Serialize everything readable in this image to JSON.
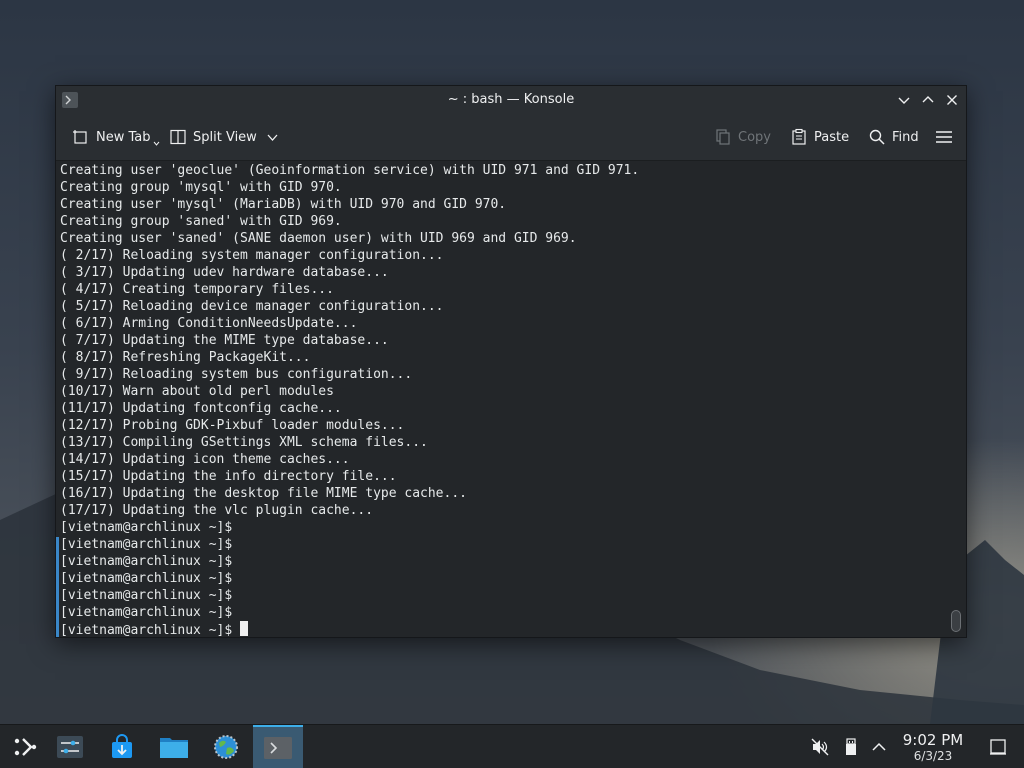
{
  "window": {
    "title": "~ : bash — Konsole"
  },
  "toolbar": {
    "new_tab_label": "New Tab",
    "split_view_label": "Split View",
    "copy_label": "Copy",
    "paste_label": "Paste",
    "find_label": "Find"
  },
  "terminal": {
    "lines": [
      "Creating user 'geoclue' (Geoinformation service) with UID 971 and GID 971.",
      "Creating group 'mysql' with GID 970.",
      "Creating user 'mysql' (MariaDB) with UID 970 and GID 970.",
      "Creating group 'saned' with GID 969.",
      "Creating user 'saned' (SANE daemon user) with UID 969 and GID 969.",
      "( 2/17) Reloading system manager configuration...",
      "( 3/17) Updating udev hardware database...",
      "( 4/17) Creating temporary files...",
      "( 5/17) Reloading device manager configuration...",
      "( 6/17) Arming ConditionNeedsUpdate...",
      "( 7/17) Updating the MIME type database...",
      "( 8/17) Refreshing PackageKit...",
      "( 9/17) Reloading system bus configuration...",
      "(10/17) Warn about old perl modules",
      "(11/17) Updating fontconfig cache...",
      "(12/17) Probing GDK-Pixbuf loader modules...",
      "(13/17) Compiling GSettings XML schema files...",
      "(14/17) Updating icon theme caches...",
      "(15/17) Updating the info directory file...",
      "(16/17) Updating the desktop file MIME type cache...",
      "(17/17) Updating the vlc plugin cache...",
      "[vietnam@archlinux ~]$",
      "[vietnam@archlinux ~]$",
      "[vietnam@archlinux ~]$",
      "[vietnam@archlinux ~]$",
      "[vietnam@archlinux ~]$",
      "[vietnam@archlinux ~]$",
      "[vietnam@archlinux ~]$ "
    ]
  },
  "taskbar": {
    "items": [
      {
        "name": "application-launcher-icon"
      },
      {
        "name": "system-settings-icon"
      },
      {
        "name": "discover-store-icon"
      },
      {
        "name": "file-manager-icon"
      },
      {
        "name": "web-browser-icon"
      },
      {
        "name": "konsole-icon"
      }
    ],
    "tray": [
      {
        "name": "volume-muted-icon"
      },
      {
        "name": "usb-device-icon"
      },
      {
        "name": "chevron-up-icon"
      }
    ],
    "clock": {
      "time": "9:02 PM",
      "date": "6/3/23"
    }
  },
  "colors": {
    "accent": "#3daee9",
    "terminal_bg": "#232629",
    "terminal_fg": "#e6e9ea"
  }
}
